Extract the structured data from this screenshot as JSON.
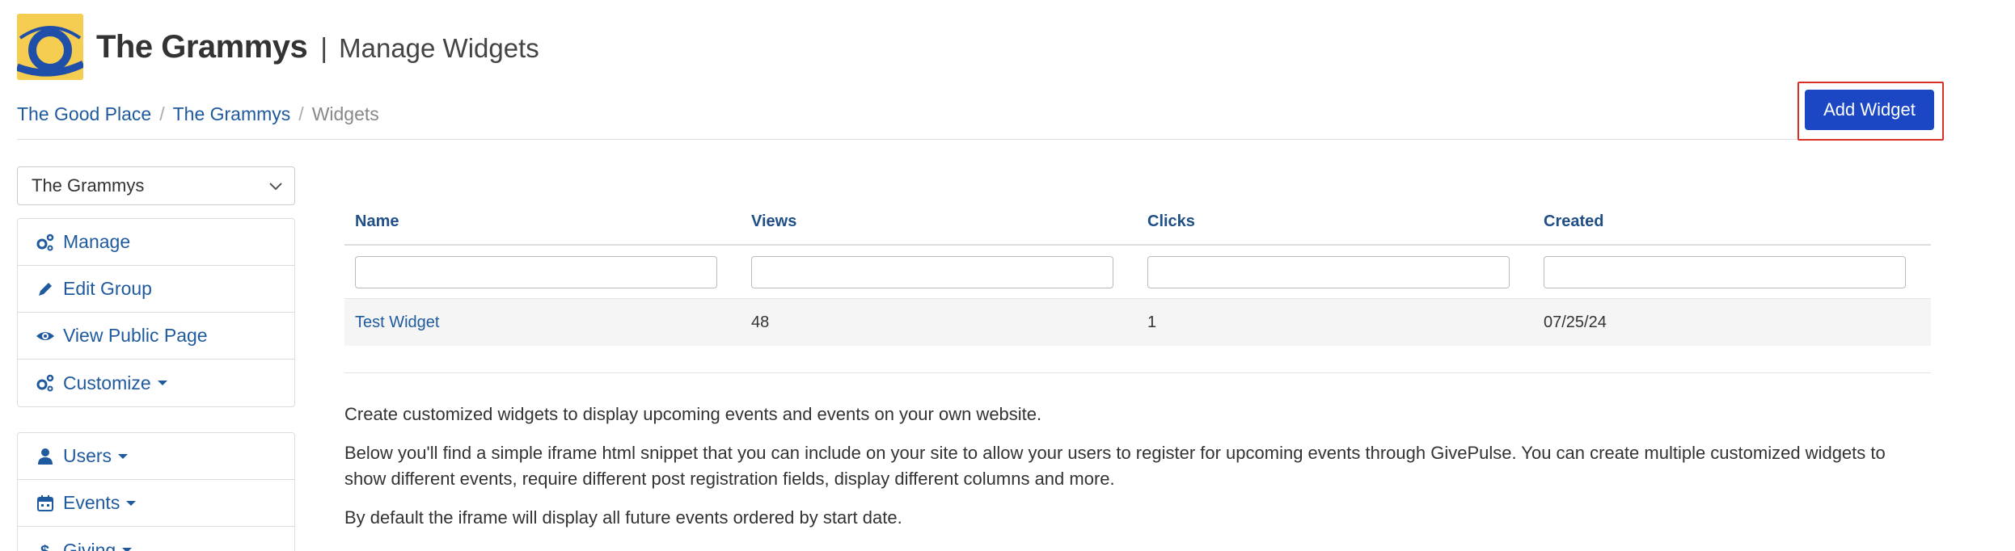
{
  "header": {
    "org_name": "The Grammys",
    "separator": "|",
    "page_title": "Manage Widgets",
    "logo_colors": {
      "background": "#f5cd50",
      "ring": "#1f4fa8"
    }
  },
  "breadcrumb": {
    "items": [
      "The Good Place",
      "The Grammys"
    ],
    "divider": "/",
    "active": "Widgets"
  },
  "toolbar": {
    "add_widget_label": "Add Widget",
    "accent": "#1b47c4",
    "highlight": "#d93025"
  },
  "sidebar": {
    "group_select": {
      "value": "The Grammys"
    },
    "primary_items": [
      {
        "label": "Manage",
        "icon": "gears-icon"
      },
      {
        "label": "Edit Group",
        "icon": "pencil-icon"
      },
      {
        "label": "View Public Page",
        "icon": "eye-icon"
      },
      {
        "label": "Customize",
        "icon": "gears-icon",
        "dropdown": true
      }
    ],
    "secondary_items": [
      {
        "label": "Users",
        "icon": "user-icon",
        "dropdown": true
      },
      {
        "label": "Events",
        "icon": "calendar-icon",
        "dropdown": true
      },
      {
        "label": "Giving",
        "icon": "dollar-icon",
        "dropdown": true
      }
    ]
  },
  "table": {
    "columns": [
      "Name",
      "Views",
      "Clicks",
      "Created"
    ],
    "rows": [
      {
        "name": "Test Widget",
        "views": "48",
        "clicks": "1",
        "created": "07/25/24"
      }
    ]
  },
  "description": {
    "p1": "Create customized widgets to display upcoming events and events on your own website.",
    "p2": "Below you'll find a simple iframe html snippet that you can include on your site to allow your users to register for upcoming events through GivePulse. You can create multiple customized widgets to show different events, require different post registration fields, display different columns and more.",
    "p3": "By default the iframe will display all future events ordered by start date."
  }
}
